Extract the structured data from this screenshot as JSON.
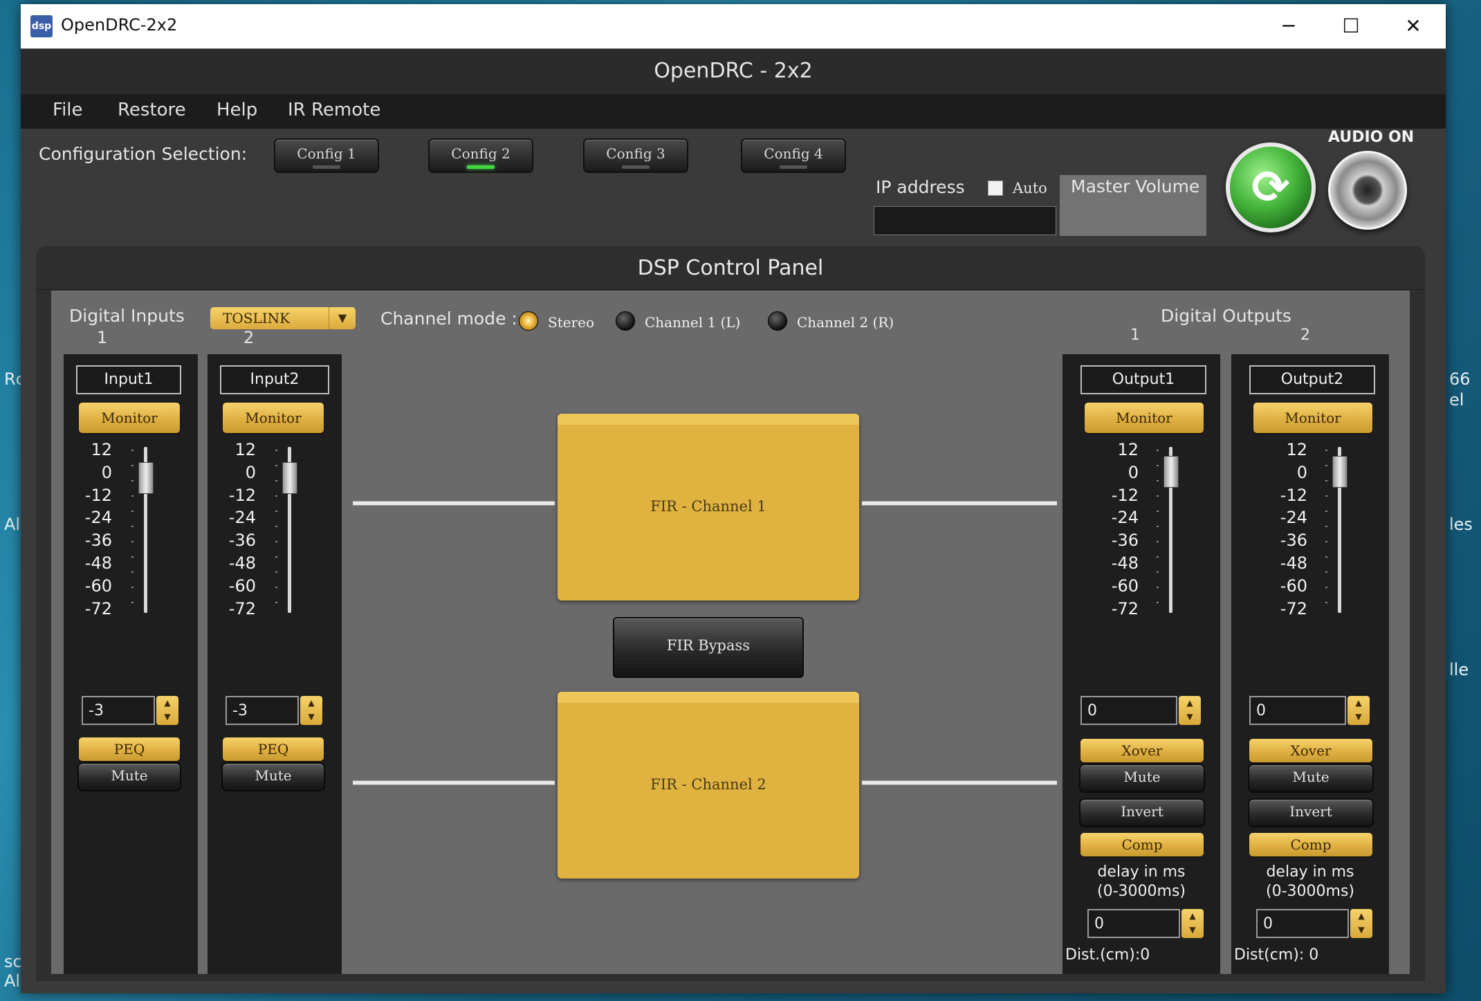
{
  "desktop": {
    "left_texts": [
      "Rc",
      "Al",
      "sc",
      "Al"
    ],
    "right_texts": [
      "66",
      "el",
      "les",
      "lle"
    ]
  },
  "window": {
    "title": "OpenDRC-2x2",
    "icon_text": "dsp",
    "controls": {
      "minimize": "─",
      "maximize": "☐",
      "close": "✕"
    }
  },
  "app": {
    "header_title": "OpenDRC - 2x2",
    "menu": [
      "File",
      "Restore",
      "Help",
      "IR Remote"
    ]
  },
  "config": {
    "label": "Configuration Selection:",
    "buttons": [
      "Config 1",
      "Config 2",
      "Config 3",
      "Config 4"
    ],
    "active_index": 1
  },
  "network": {
    "ip_label": "IP address",
    "ip_value": "",
    "auto_label": "Auto",
    "auto_checked": false,
    "master_volume_label": "Master Volume"
  },
  "audio": {
    "label": "AUDIO ON",
    "refresh_symbol": "⟳"
  },
  "dsp": {
    "title": "DSP Control Panel",
    "digital_inputs_label": "Digital Inputs",
    "input_source": "TOSLINK",
    "dropdown_arrow": "▼",
    "channel_mode_label": "Channel mode :",
    "channel_modes": [
      "Stereo",
      "Channel 1 (L)",
      "Channel 2 (R)"
    ],
    "channel_mode_selected": "Stereo",
    "digital_outputs_label": "Digital Outputs",
    "scale": [
      "12",
      "0",
      "-12",
      "-24",
      "-36",
      "-48",
      "-60",
      "-72"
    ],
    "spin_arrows": "▲\n▼",
    "inputs": [
      {
        "number": "1",
        "name": "Input1",
        "monitor": "Monitor",
        "gain": "-3",
        "gain_db": -3,
        "peq": "PEQ",
        "mute": "Mute"
      },
      {
        "number": "2",
        "name": "Input2",
        "monitor": "Monitor",
        "gain": "-3",
        "gain_db": -3,
        "peq": "PEQ",
        "mute": "Mute"
      }
    ],
    "fir": {
      "channel1": "FIR - Channel 1",
      "channel2": "FIR - Channel 2",
      "bypass": "FIR Bypass"
    },
    "outputs": [
      {
        "number": "1",
        "name": "Output1",
        "monitor": "Monitor",
        "gain": "0",
        "gain_db": 0,
        "xover": "Xover",
        "mute": "Mute",
        "invert": "Invert",
        "comp": "Comp",
        "delay_label_1": "delay in ms",
        "delay_label_2": "(0-3000ms)",
        "delay": "0",
        "dist": "Dist.(cm):0"
      },
      {
        "number": "2",
        "name": "Output2",
        "monitor": "Monitor",
        "gain": "0",
        "gain_db": 0,
        "xover": "Xover",
        "mute": "Mute",
        "invert": "Invert",
        "comp": "Comp",
        "delay_label_1": "delay in ms",
        "delay_label_2": "(0-3000ms)",
        "delay": "0",
        "dist": "Dist(cm): 0"
      }
    ]
  }
}
